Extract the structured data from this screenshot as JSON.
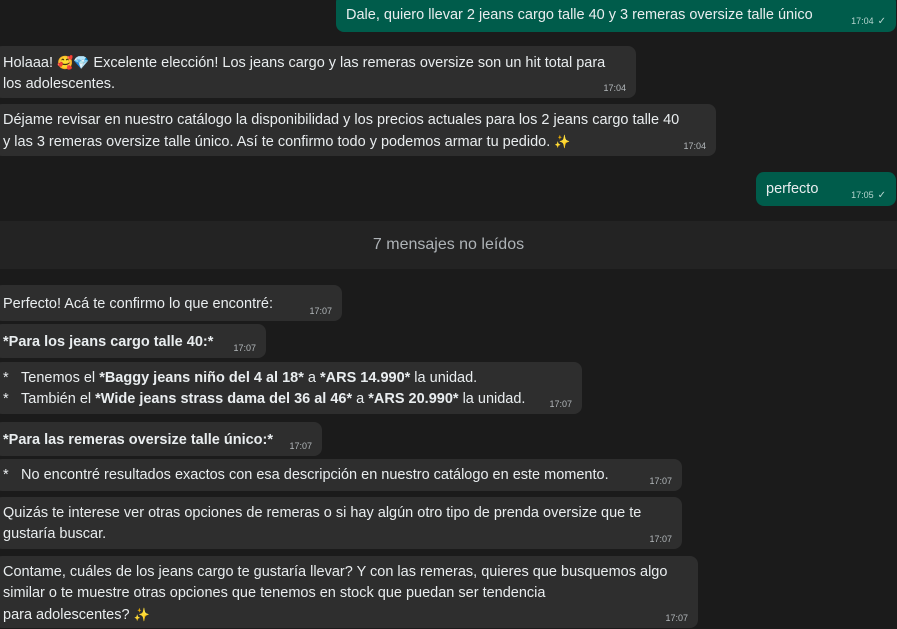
{
  "messages": {
    "m1": {
      "text": "Dale, quiero llevar 2 jeans cargo talle 40 y 3 remeras oversize talle único",
      "time": "17:04",
      "status": "✓"
    },
    "m2": {
      "text_a": "Holaaa! ",
      "emoji": "🥰💎",
      "text_b": " Excelente elección! Los jeans cargo y las remeras oversize son un hit total para",
      "text_c": "los adolescentes.",
      "time": "17:04"
    },
    "m3": {
      "line1": "Déjame revisar en nuestro catálogo la disponibilidad y los precios actuales para los 2 jeans cargo talle 40",
      "line2": "y las 3 remeras oversize talle único. Así te confirmo todo y podemos armar tu pedido. ",
      "emoji": "✨",
      "time": "17:04"
    },
    "m4": {
      "text": "perfecto",
      "time": "17:05",
      "status": "✓"
    },
    "unread": "7 mensajes no leídos",
    "m5": {
      "text": "Perfecto! Acá te confirmo lo que encontré:",
      "time": "17:07"
    },
    "m6": {
      "text": "*Para los jeans cargo talle 40:*",
      "time": "17:07"
    },
    "m7": {
      "star": "*",
      "b1_pre": "Tenemos el ",
      "b1_bold": "*Baggy jeans niño del 4 al 18*",
      "b1_mid": " a ",
      "b1_price": "*ARS 14.990*",
      "b1_post": " la unidad.",
      "b2_pre": "También el ",
      "b2_bold": "*Wide jeans strass dama del 36 al 46*",
      "b2_mid": " a ",
      "b2_price": "*ARS 20.990*",
      "b2_post": " la unidad.",
      "time": "17:07"
    },
    "m8": {
      "text": "*Para las remeras oversize talle único:*",
      "time": "17:07"
    },
    "m9": {
      "star": "*",
      "text": "No encontré resultados exactos con esa descripción en nuestro catálogo en este momento.",
      "time": "17:07"
    },
    "m10": {
      "line1": "Quizás te interese ver otras opciones de remeras o si hay algún otro tipo de prenda oversize que te",
      "line2": "gustaría buscar.",
      "time": "17:07"
    },
    "m11": {
      "line1": "Contame, cuáles de los jeans cargo te gustaría llevar? Y con las remeras, quieres que busquemos algo",
      "line2": "similar o te muestre otras opciones que tenemos en stock que puedan ser tendencia",
      "line3": "para adolescentes? ",
      "emoji": "✨",
      "time": "17:07"
    }
  }
}
